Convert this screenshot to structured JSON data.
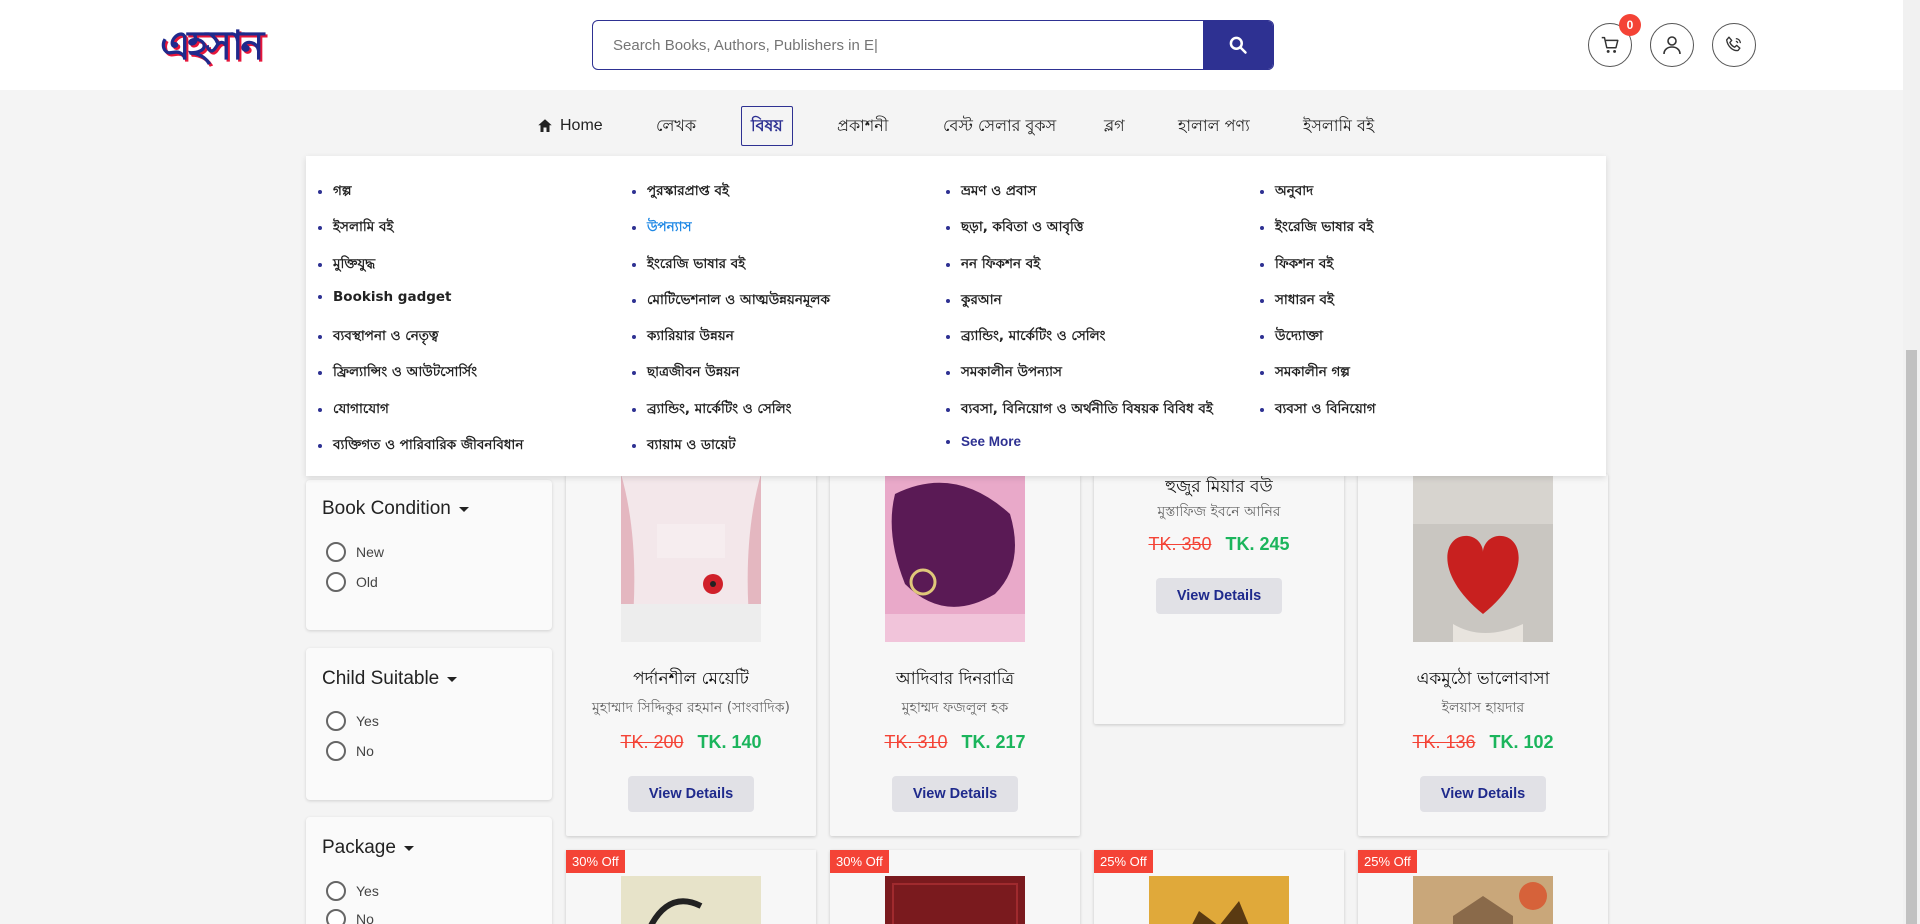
{
  "header": {
    "logo_text": "এহসান",
    "search_placeholder": "Search Books, Authors, Publishers in E|",
    "cart_count": "0"
  },
  "nav": {
    "home": "Home",
    "items": [
      "লেখক",
      "বিষয়",
      "প্রকাশনী",
      "বেস্ট সেলার বুকস",
      "ব্লগ",
      "হালাল পণ্য",
      "ইসলামি বই"
    ]
  },
  "mega": {
    "col1": [
      "গল্প",
      "ইসলামি বই",
      "মুক্তিযুদ্ধ",
      "Bookish gadget",
      "ব্যবস্থাপনা ও নেতৃত্ব",
      "ফ্রিল্যান্সিং ও আউটসোর্সিং",
      "যোগাযোগ",
      "ব্যক্তিগত ও পারিবারিক জীবনবিধান"
    ],
    "col2": [
      "পুরস্কারপ্রাপ্ত বই",
      "উপন্যাস",
      "ইংরেজি ভাষার বই",
      "মোটিভেশনাল ও আত্মউন্নয়নমূলক",
      "ক্যারিয়ার উন্নয়ন",
      "ছাত্রজীবন উন্নয়ন",
      "ব্র্যান্ডিং, মার্কেটিং ও সেলিং",
      "ব্যায়াম ও ডায়েট"
    ],
    "col3": [
      "ভ্রমণ ও প্রবাস",
      "ছড়া, কবিতা ও আবৃত্তি",
      "নন ফিকশন বই",
      "কুরআন",
      "ব্র্যান্ডিং, মার্কেটিং ও সেলিং",
      "সমকালীন উপন্যাস",
      "ব্যবসা, বিনিয়োগ ও অর্থনীতি বিষয়ক বিবিধ বই",
      "See More"
    ],
    "col4": [
      "অনুবাদ",
      "ইংরেজি ভাষার বই",
      "ফিকশন বই",
      "সাধারন বই",
      "উদ্যোক্তা",
      "সমকালীন গল্প",
      "ব্যবসা ও বিনিয়োগ"
    ]
  },
  "filters": {
    "condition": {
      "title": "Book Condition",
      "options": [
        "New",
        "Old"
      ]
    },
    "child": {
      "title": "Child Suitable",
      "options": [
        "Yes",
        "No"
      ]
    },
    "package": {
      "title": "Package",
      "options": [
        "Yes",
        "No"
      ]
    }
  },
  "products": [
    {
      "title": "পর্দানশীল মেয়েটি",
      "author": "মুহাম্মাদ সিদ্দিকুর রহমান (সাংবাদিক)",
      "old_price": "TK. 200",
      "new_price": "TK. 140",
      "button": "View Details"
    },
    {
      "title": "আদিবার দিনরাত্রি",
      "author": "মুহাম্মদ ফজলুল হক",
      "old_price": "TK. 310",
      "new_price": "TK. 217",
      "button": "View Details"
    },
    {
      "title": "হুজুর মিয়ার বউ",
      "author": "মুস্তাফিজ ইবনে আনির",
      "old_price": "TK. 350",
      "new_price": "TK. 245",
      "button": "View Details"
    },
    {
      "title": "একমুঠো ভালোবাসা",
      "author": "ইলয়াস হায়দার",
      "old_price": "TK. 136",
      "new_price": "TK. 102",
      "button": "View Details"
    }
  ],
  "second_row_badges": [
    "30% Off",
    "30% Off",
    "25% Off",
    "25% Off"
  ],
  "colors": {
    "brand": "#2e3192",
    "sale": "#1bb55c",
    "old": "#f44336"
  }
}
